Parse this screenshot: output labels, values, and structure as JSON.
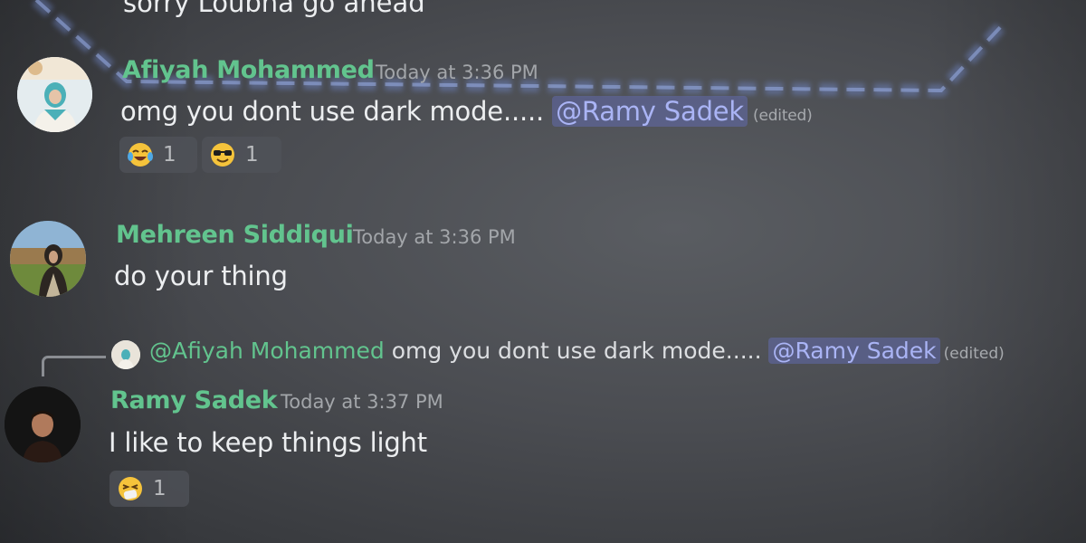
{
  "top_partial": {
    "text": "sorry Loubna go ahead"
  },
  "colors": {
    "username": "#62c48e",
    "mention_bg": "#6e78dc",
    "mention_text": "#aab4f5",
    "background": "#4a4c51"
  },
  "messages": [
    {
      "author": "Afiyah Mohammed",
      "timestamp": "Today at 3:36 PM",
      "content": "omg you dont use dark mode.....",
      "mention": "@Ramy Sadek",
      "edited": "(edited)",
      "reactions": [
        {
          "emoji": "joy-emoji",
          "count": "1"
        },
        {
          "emoji": "sunglasses-emoji",
          "count": "1"
        }
      ]
    },
    {
      "author": "Mehreen Siddiqui",
      "timestamp": "Today at 3:36 PM",
      "content": "do your thing"
    },
    {
      "reply": {
        "author": "@Afiyah Mohammed",
        "content": "omg you dont use dark mode.....",
        "mention": "@Ramy Sadek",
        "edited": "(edited)"
      },
      "author": "Ramy Sadek",
      "timestamp": "Today at 3:37 PM",
      "content": "I like to keep things light",
      "reactions": [
        {
          "emoji": "sneezing-face-emoji",
          "count": "1"
        }
      ]
    }
  ]
}
